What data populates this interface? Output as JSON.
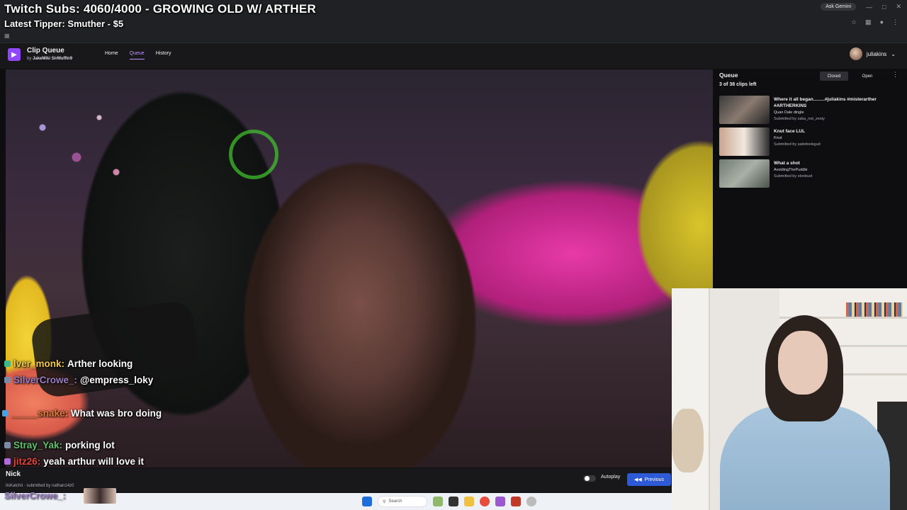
{
  "overlay": {
    "subs": "Twitch Subs: 4060/4000 - GROWING OLD W/ ARTHER",
    "tipper": "Latest Tipper: Smuther - $5"
  },
  "browser": {
    "ask_gemini": "Ask Gemini",
    "icons": [
      "star-icon",
      "extension-icon",
      "profile-icon",
      "menu-icon"
    ]
  },
  "app": {
    "title": "Clip Queue",
    "authors_prefix": "by",
    "author1": "JakeMiki",
    "author2": "SirMuffin9",
    "nav": [
      "Home",
      "Queue",
      "History"
    ],
    "active_nav": "Queue",
    "username": "juliakins"
  },
  "queue": {
    "title": "Queue",
    "count": "3 of 38 clips left",
    "closed_label": "Closed",
    "open_label": "Open",
    "items": [
      {
        "title": "Where it all began.........#juliakins #misterarther #ARTHERKINS",
        "by": "Quan Dale dingle",
        "submitted": "Submitted by zaka_not_zesty"
      },
      {
        "title": "Knut face LUL",
        "by": "Knut",
        "submitted": "Submitted by satisfeelsgud"
      },
      {
        "title": "What a shot",
        "by": "AvoidingThePuddle",
        "submitted": "Submitted by elonbust"
      }
    ]
  },
  "chat": [
    {
      "user": "lver_monk:",
      "text": "Arther looking",
      "user_color": "#f2c94c"
    },
    {
      "user": "SilverCrowe_:",
      "text": "@empress_loky",
      "user_color": "#9b7dc6"
    },
    {
      "user": "_____snake:",
      "text": "What was bro doing",
      "user_color": "#e07a3c"
    },
    {
      "user": "Stray_Yak:",
      "text": "porking lot",
      "user_color": "#5ec26a"
    },
    {
      "user": "jitz26:",
      "text": "yeah arthur will love it",
      "user_color": "#e0453c"
    }
  ],
  "player": {
    "clip_title": "Nick",
    "clip_sub": "itsKatchii · submitted by nathan14z0",
    "autoplay_label": "Autoplay",
    "previous_label": "Previous"
  },
  "bottom_chat_user": "SilverCrowe_:",
  "taskbar": {
    "search_placeholder": "Search"
  },
  "colors": {
    "accent": "#9147ff",
    "previous_button": "#2d5bd7"
  }
}
